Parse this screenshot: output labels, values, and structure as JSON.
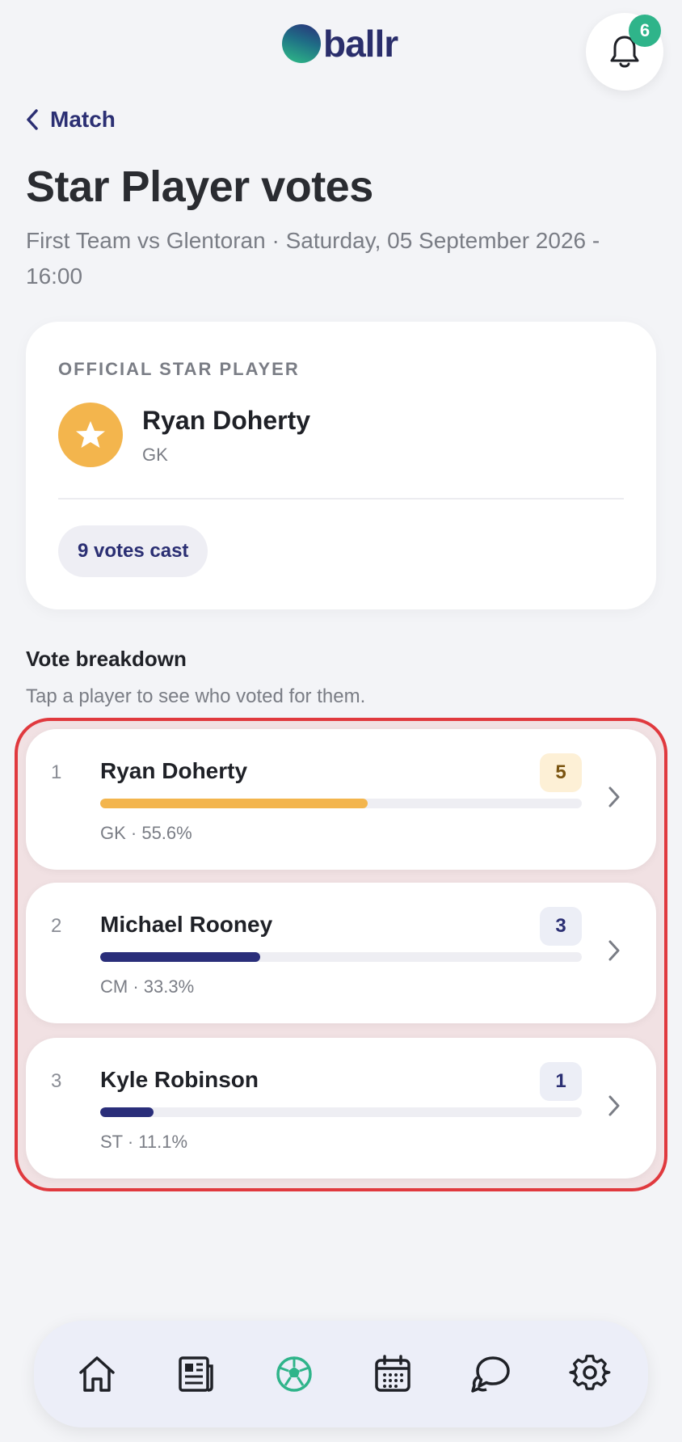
{
  "header": {
    "logo_text": "ballr",
    "notification_count": "6"
  },
  "nav": {
    "back_label": "Match"
  },
  "page": {
    "title": "Star Player votes",
    "subtitle": "First Team vs Glentoran · Saturday, 05 September 2026 - 16:00"
  },
  "official": {
    "label": "OFFICIAL STAR PLAYER",
    "name": "Ryan Doherty",
    "position": "GK",
    "votes_cast": "9 votes cast"
  },
  "breakdown": {
    "title": "Vote breakdown",
    "hint": "Tap a player to see who voted for them.",
    "players": [
      {
        "rank": "1",
        "name": "Ryan Doherty",
        "votes": "5",
        "meta": "GK · 55.6%",
        "share": 0.556,
        "bar_color": "#f3b54d",
        "badge_bg": "#fdf0d6",
        "badge_color": "#7a5410"
      },
      {
        "rank": "2",
        "name": "Michael Rooney",
        "votes": "3",
        "meta": "CM · 33.3%",
        "share": 0.333,
        "bar_color": "#2a2e7a",
        "badge_bg": "#eceef6",
        "badge_color": "#2b2f73"
      },
      {
        "rank": "3",
        "name": "Kyle Robinson",
        "votes": "1",
        "meta": "ST · 11.1%",
        "share": 0.111,
        "bar_color": "#2a2e7a",
        "badge_bg": "#eceef6",
        "badge_color": "#2b2f73"
      }
    ]
  },
  "bottom_nav": {
    "items": [
      {
        "icon": "home-icon"
      },
      {
        "icon": "news-icon"
      },
      {
        "icon": "football-icon",
        "active": true
      },
      {
        "icon": "calendar-icon"
      },
      {
        "icon": "chat-icon"
      },
      {
        "icon": "settings-icon"
      }
    ]
  },
  "colors": {
    "accent": "#2b2f73",
    "active_nav": "#2fb48a",
    "star": "#f3b54d",
    "highlight": "#e0393e"
  }
}
